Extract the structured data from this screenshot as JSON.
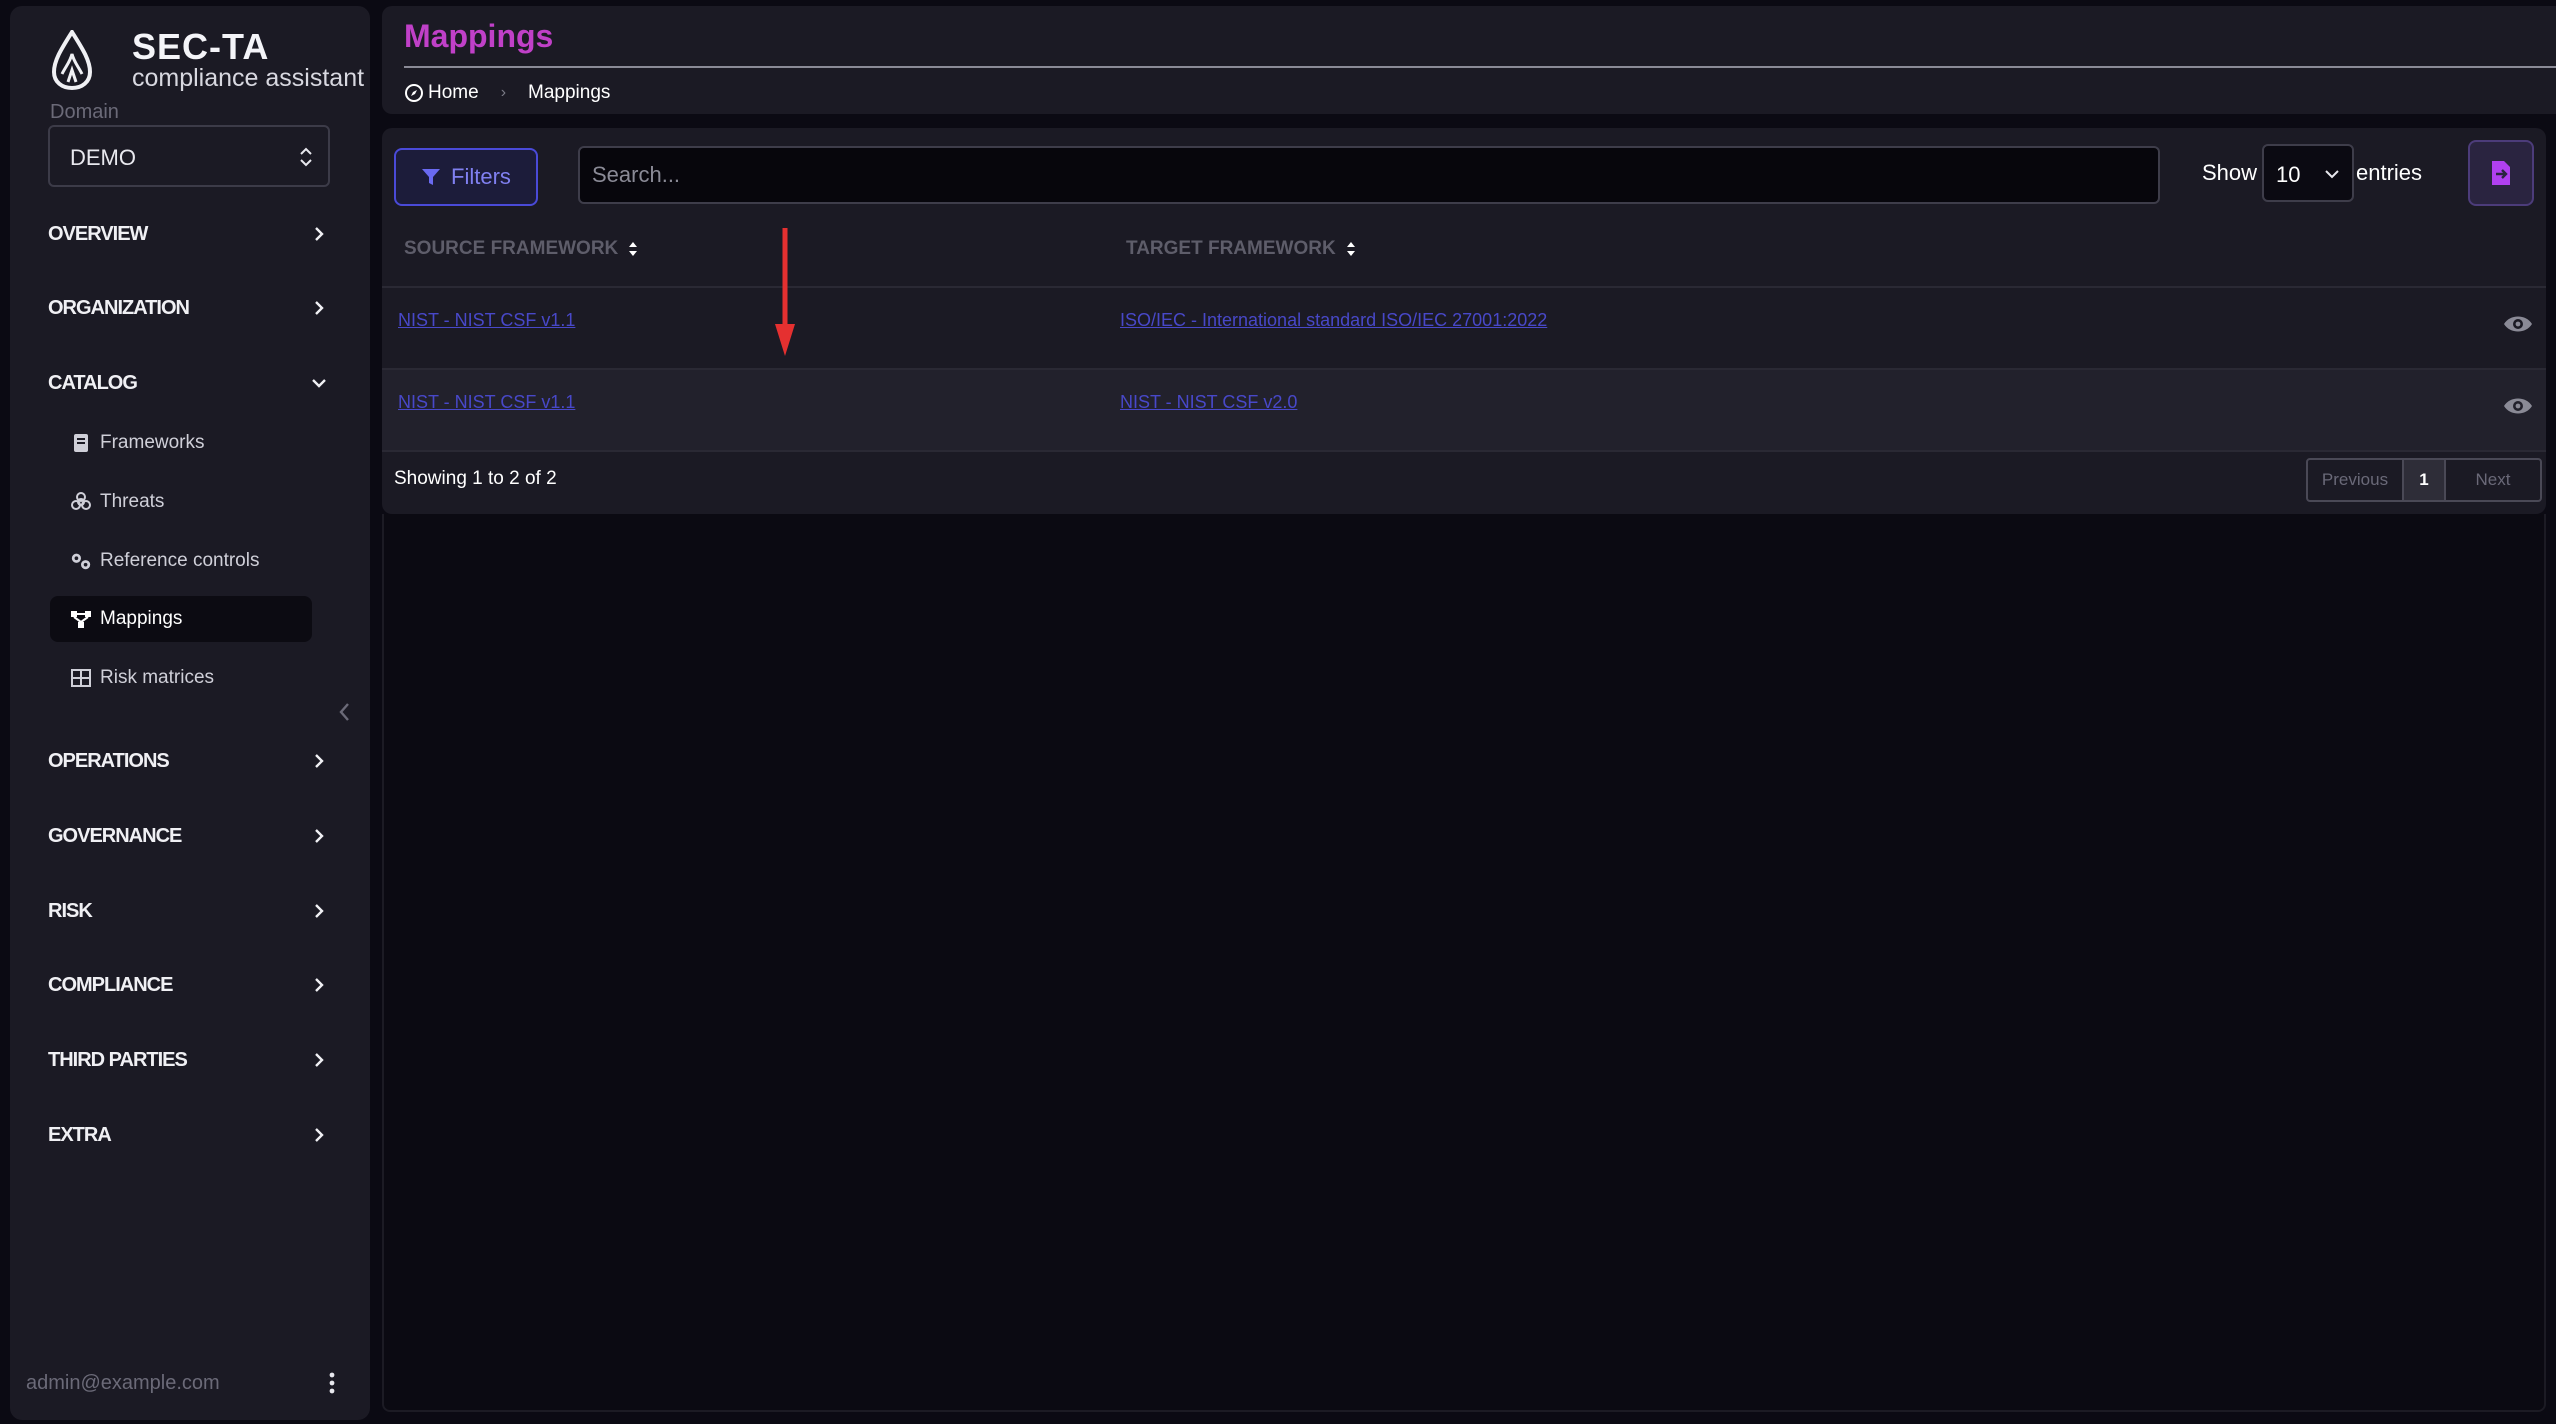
{
  "app": {
    "title": "SEC-TA",
    "subtitle": "compliance assistant",
    "domain_label": "Domain",
    "domain_value": "DEMO"
  },
  "sidebar": {
    "groups": [
      {
        "label": "OVERVIEW"
      },
      {
        "label": "ORGANIZATION"
      },
      {
        "label": "CATALOG"
      },
      {
        "label": "OPERATIONS"
      },
      {
        "label": "GOVERNANCE"
      },
      {
        "label": "RISK"
      },
      {
        "label": "COMPLIANCE"
      },
      {
        "label": "THIRD PARTIES"
      },
      {
        "label": "EXTRA"
      }
    ],
    "catalog_items": [
      {
        "label": "Frameworks",
        "icon": "book-icon"
      },
      {
        "label": "Threats",
        "icon": "biohazard-icon"
      },
      {
        "label": "Reference controls",
        "icon": "gears-icon"
      },
      {
        "label": "Mappings",
        "icon": "diagram-icon",
        "active": true
      },
      {
        "label": "Risk matrices",
        "icon": "grid-icon"
      }
    ],
    "user_email": "admin@example.com"
  },
  "header": {
    "title": "Mappings",
    "breadcrumb": [
      "Home",
      "Mappings"
    ]
  },
  "toolbar": {
    "filters_label": "Filters",
    "search_placeholder": "Search...",
    "show_label": "Show",
    "entries_value": "10",
    "entries_label": "entries"
  },
  "table": {
    "columns": [
      "SOURCE FRAMEWORK",
      "TARGET FRAMEWORK"
    ],
    "rows": [
      {
        "source": "NIST - NIST CSF v1.1",
        "target": "ISO/IEC - International standard ISO/IEC 27001:2022"
      },
      {
        "source": "NIST - NIST CSF v1.1",
        "target": "NIST - NIST CSF v2.0"
      }
    ],
    "showing": "Showing 1 to 2 of 2",
    "pagination": {
      "previous": "Previous",
      "current": "1",
      "next": "Next"
    }
  },
  "colors": {
    "accent": "#c040c8",
    "link": "#4848c8",
    "annotation_arrow": "#e53030"
  }
}
